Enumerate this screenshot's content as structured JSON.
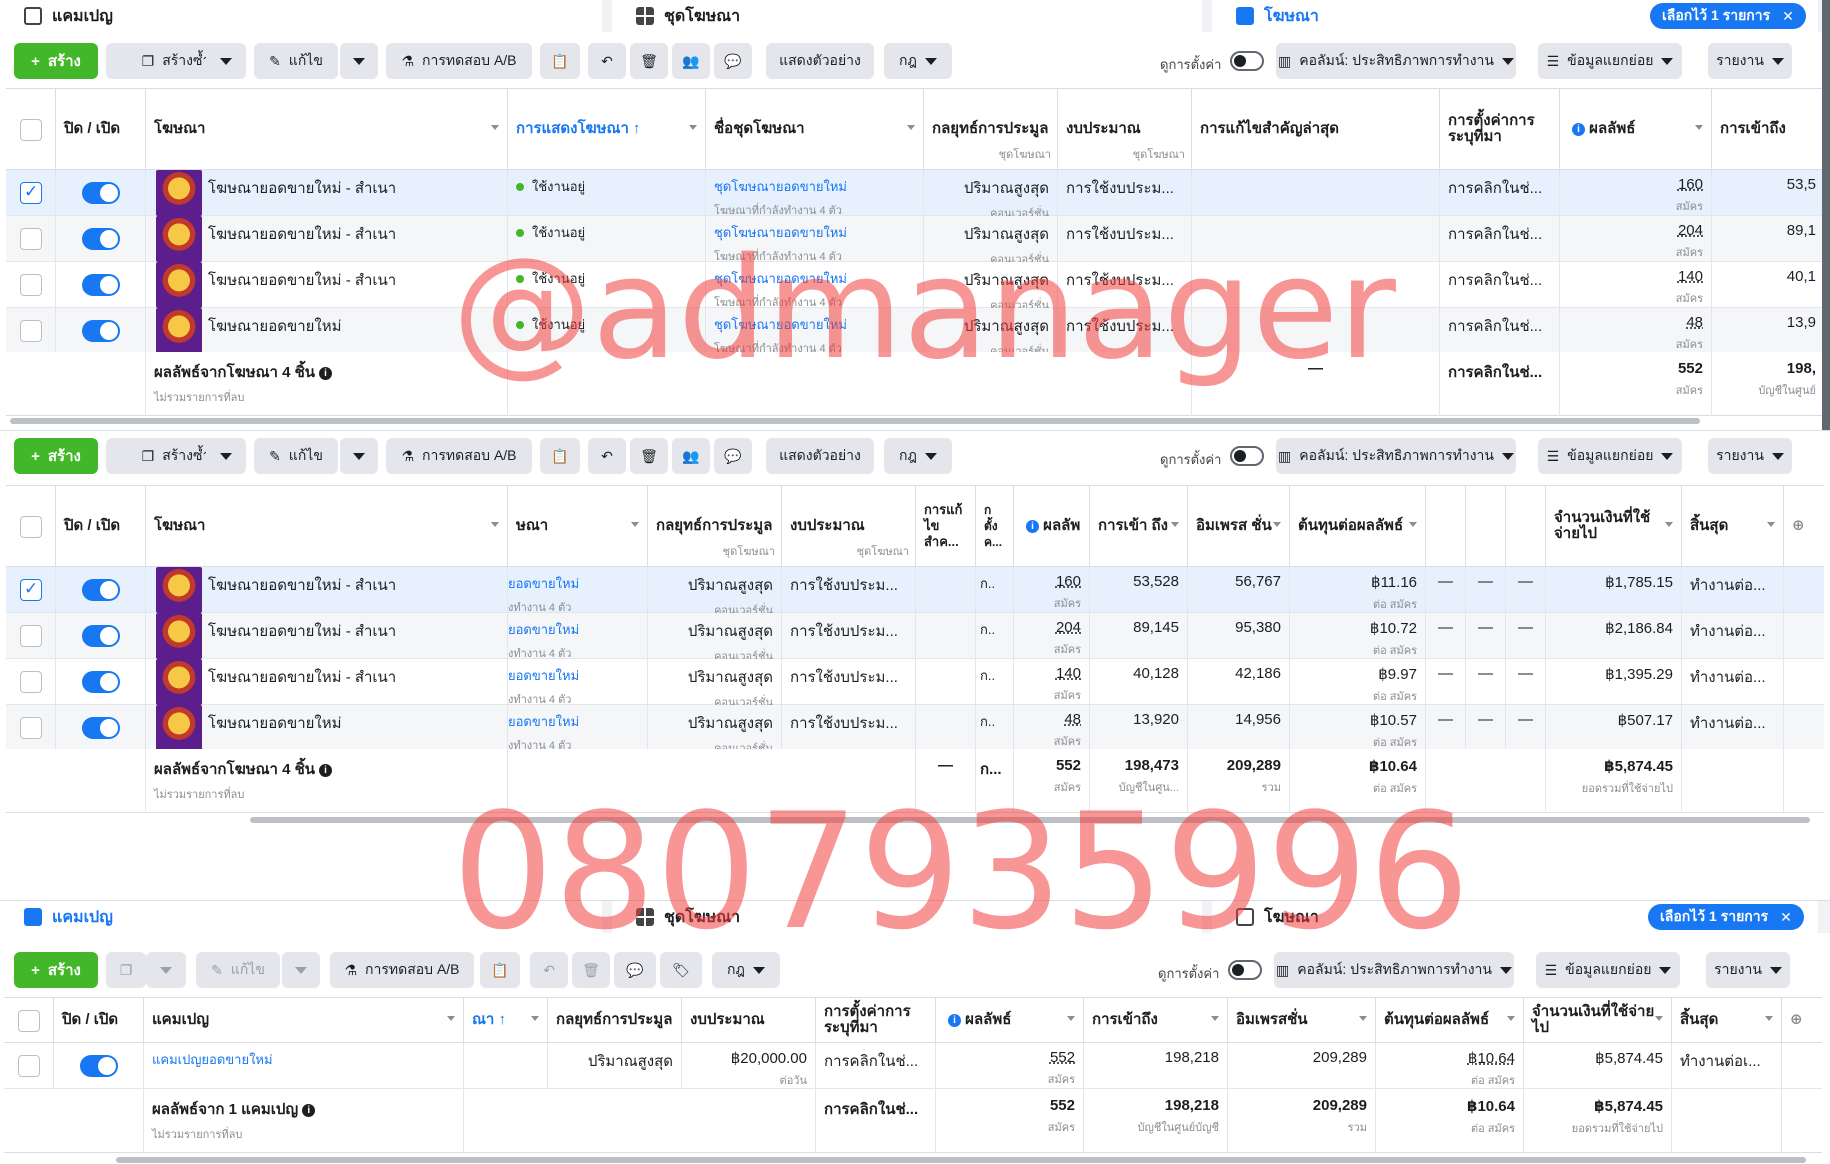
{
  "tabs": {
    "campaign": "แคมเปญ",
    "adset": "ชุดโฆษณา",
    "ad": "โฆษณา",
    "selected": "เลือกไว้ 1 รายการ"
  },
  "toolbar": {
    "create": "สร้าง",
    "duplicate": "สร้างซ้ำ",
    "edit": "แก้ไข",
    "ab_test": "การทดสอบ A/B",
    "preview": "แสดงตัวอย่าง",
    "rules": "กฎ",
    "view_setup": "ดูการตั้งค่า",
    "columns": "คอลัมน์: ประสิทธิภาพการทำงาน",
    "breakdown": "ข้อมูลแยกย่อย",
    "reports": "รายงาน"
  },
  "headers": {
    "onoff": "ปิด / เปิด",
    "ad": "โฆษณา",
    "campaign": "แคมเปญ",
    "delivery": "การแสดงโฆษณา ↑",
    "delivery_cut": "ณา ↑",
    "adset_name": "ชื่อชุดโฆษณา",
    "adset_name_cut": "ษณา",
    "bid": "กลยุทธ์การประมูล",
    "budget": "งบประมาณ",
    "adset_sub": "ชุดโฆษณา",
    "last_edit": "การแก้ไขสำคัญล่าสุด",
    "last_edit_short": "การแก้ไขสำค...",
    "attr": "การตั้งค่าการระบุที่มา",
    "attr_short": "ก ตั้ง ค...",
    "results": "ผลลัพธ์",
    "results_short": "ผลลัพ",
    "reach": "การเข้าถึง",
    "reach_short": "การเข้า ถึง",
    "impressions": "อิมเพรสชั่น",
    "impressions_short": "อิมเพรส ชั่น",
    "cpr": "ต้นทุนต่อผลลัพธ์",
    "spent": "จำนวนเงินที่ใช้จ่ายไป",
    "ends": "สิ้นสุด"
  },
  "ads": [
    {
      "name": "โฆษณายอดขายใหม่ - สำเนา",
      "status": "ใช้งานอยู่",
      "adset": "ชุดโฆษณายอดขายใหม่",
      "adset_cut": "ยอดขายใหม่",
      "adset_note": "โฆษณาที่กำลังทำงาน 4 ตัว",
      "adset_note_cut": "ังทำงาน 4 ตัว",
      "bid": "ปริมาณสูงสุด",
      "bid_sub": "คอนเวอร์ชั่น",
      "budget": "การใช้งบประม...",
      "attr": "การคลิกในช่...",
      "attr_cut": "ก..",
      "results": "160",
      "results_unit": "สมัคร",
      "reach": "53,528",
      "reach_cut": "53,5",
      "impressions": "56,767",
      "cpr": "฿11.16",
      "cpr_unit": "ต่อ สมัคร",
      "spent": "฿1,785.15",
      "ends": "ทำงานต่อ...",
      "checked": true
    },
    {
      "name": "โฆษณายอดขายใหม่ - สำเนา",
      "status": "ใช้งานอยู่",
      "adset": "ชุดโฆษณายอดขายใหม่",
      "adset_cut": "ยอดขายใหม่",
      "adset_note": "โฆษณาที่กำลังทำงาน 4 ตัว",
      "adset_note_cut": "ังทำงาน 4 ตัว",
      "bid": "ปริมาณสูงสุด",
      "bid_sub": "คอนเวอร์ชั่น",
      "budget": "การใช้งบประม...",
      "attr": "การคลิกในช่...",
      "attr_cut": "ก..",
      "results": "204",
      "results_unit": "สมัคร",
      "reach": "89,145",
      "reach_cut": "89,1",
      "impressions": "95,380",
      "cpr": "฿10.72",
      "cpr_unit": "ต่อ สมัคร",
      "spent": "฿2,186.84",
      "ends": "ทำงานต่อ...",
      "checked": false
    },
    {
      "name": "โฆษณายอดขายใหม่ - สำเนา",
      "status": "ใช้งานอยู่",
      "adset": "ชุดโฆษณายอดขายใหม่",
      "adset_cut": "ยอดขายใหม่",
      "adset_note": "โฆษณาที่กำลังทำงาน 4 ตัว",
      "adset_note_cut": "ังทำงาน 4 ตัว",
      "bid": "ปริมาณสูงสุด",
      "bid_sub": "คอนเวอร์ชั่น",
      "budget": "การใช้งบประม...",
      "attr": "การคลิกในช่...",
      "attr_cut": "ก..",
      "results": "140",
      "results_unit": "สมัคร",
      "reach": "40,128",
      "reach_cut": "40,1",
      "impressions": "42,186",
      "cpr": "฿9.97",
      "cpr_unit": "ต่อ สมัคร",
      "spent": "฿1,395.29",
      "ends": "ทำงานต่อ...",
      "checked": false
    },
    {
      "name": "โฆษณายอดขายใหม่",
      "status": "ใช้งานอยู่",
      "adset": "ชุดโฆษณายอดขายใหม่",
      "adset_cut": "ยอดขายใหม่",
      "adset_note": "โฆษณาที่กำลังทำงาน 4 ตัว",
      "adset_note_cut": "ังทำงาน 4 ตัว",
      "bid": "ปริมาณสูงสุด",
      "bid_sub": "คอนเวอร์ชั่น",
      "budget": "การใช้งบประม...",
      "attr": "การคลิกในช่...",
      "attr_cut": "ก..",
      "results": "48",
      "results_unit": "สมัคร",
      "reach": "13,920",
      "reach_cut": "13,9",
      "impressions": "14,956",
      "cpr": "฿10.57",
      "cpr_unit": "ต่อ สมัคร",
      "spent": "฿507.17",
      "ends": "ทำงานต่อ...",
      "checked": false
    }
  ],
  "ads_total": {
    "label": "ผลลัพธ์จากโฆษณา 4 ชิ้น",
    "note": "ไม่รวมรายการที่ลบ",
    "dash": "—",
    "attr": "การคลิกในช่...",
    "attr_cut": "ก...",
    "results": "552",
    "results_unit": "สมัคร",
    "reach": "198,473",
    "reach_cut": "198,",
    "reach_unit": "บัญชีในศูน...",
    "reach_unit_cut": "บัญชีในศูนย์",
    "impressions": "209,289",
    "impressions_unit": "รวม",
    "cpr": "฿10.64",
    "cpr_unit": "ต่อ สมัคร",
    "spent": "฿5,874.45",
    "spent_unit": "ยอดรวมที่ใช้จ่ายไป",
    "dashes": "—"
  },
  "campaign_row": {
    "name": "แคมเปญยอดขายใหม่",
    "bid": "ปริมาณสูงสุด",
    "budget": "฿20,000.00",
    "budget_unit": "ต่อวัน",
    "attr": "การคลิกในช่...",
    "results": "552",
    "results_unit": "สมัคร",
    "reach": "198,218",
    "impressions": "209,289",
    "cpr": "฿10.64",
    "cpr_unit": "ต่อ สมัคร",
    "spent": "฿5,874.45",
    "ends": "ทำงานต่อเ..."
  },
  "campaign_total": {
    "label": "ผลลัพธ์จาก 1 แคมเปญ",
    "note": "ไม่รวมรายการที่ลบ",
    "attr": "การคลิกในช่...",
    "results": "552",
    "results_unit": "สมัคร",
    "reach": "198,218",
    "reach_unit": "บัญชีในศูนย์บัญชี",
    "impressions": "209,289",
    "impressions_unit": "รวม",
    "cpr": "฿10.64",
    "cpr_unit": "ต่อ สมัคร",
    "spent": "฿5,874.45",
    "spent_unit": "ยอดรวมที่ใช้จ่ายไป"
  },
  "watermarks": {
    "handle": "@admanager",
    "phone": "0807935996"
  },
  "colors": {
    "accent": "#1877f2",
    "create": "#42b72a",
    "watermark": "#f23e3e"
  }
}
